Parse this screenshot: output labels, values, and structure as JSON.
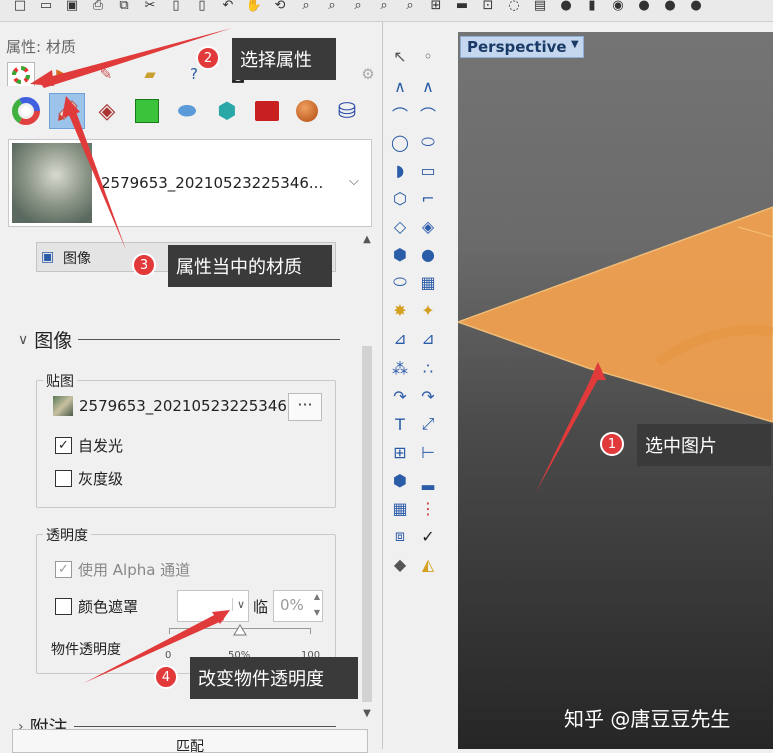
{
  "panel": {
    "title": "属性: 材质",
    "material_name": "2579653_20210523225346...",
    "type_label": "图像",
    "image_section": "图像",
    "texture_group": "贴图",
    "texture_file": "2579653_20210523225346...",
    "texture_more": "···",
    "self_illum": "自发光",
    "grayscale": "灰度级",
    "transparency_group": "透明度",
    "use_alpha": "使用 Alpha 通道",
    "color_mask": "颜色遮罩",
    "threshold_label": "临",
    "threshold_value": "0%",
    "object_transparency": "物件透明度",
    "slider_min": "0",
    "slider_mid": "50%",
    "slider_max": "100",
    "notes_section": "附注",
    "match_button": "匹配"
  },
  "states": {
    "self_illum_checked": true,
    "grayscale_checked": false,
    "use_alpha_checked": true,
    "color_mask_checked": false,
    "object_transparency_value": 0.5
  },
  "viewport": {
    "title": "Perspective"
  },
  "callouts": [
    {
      "num": "1",
      "text": "选中图片"
    },
    {
      "num": "2",
      "text": "选择属性"
    },
    {
      "num": "3",
      "text": "属性当中的材质"
    },
    {
      "num": "4",
      "text": "改变物件透明度"
    }
  ],
  "watermark": "知乎 @唐豆豆先生",
  "colors": {
    "plane": "#f0a050",
    "callout_bg": "#3a3a3a",
    "badge": "#e23a3a",
    "arrow": "#e03a3a",
    "selected_tab": "#9cc3ea"
  }
}
